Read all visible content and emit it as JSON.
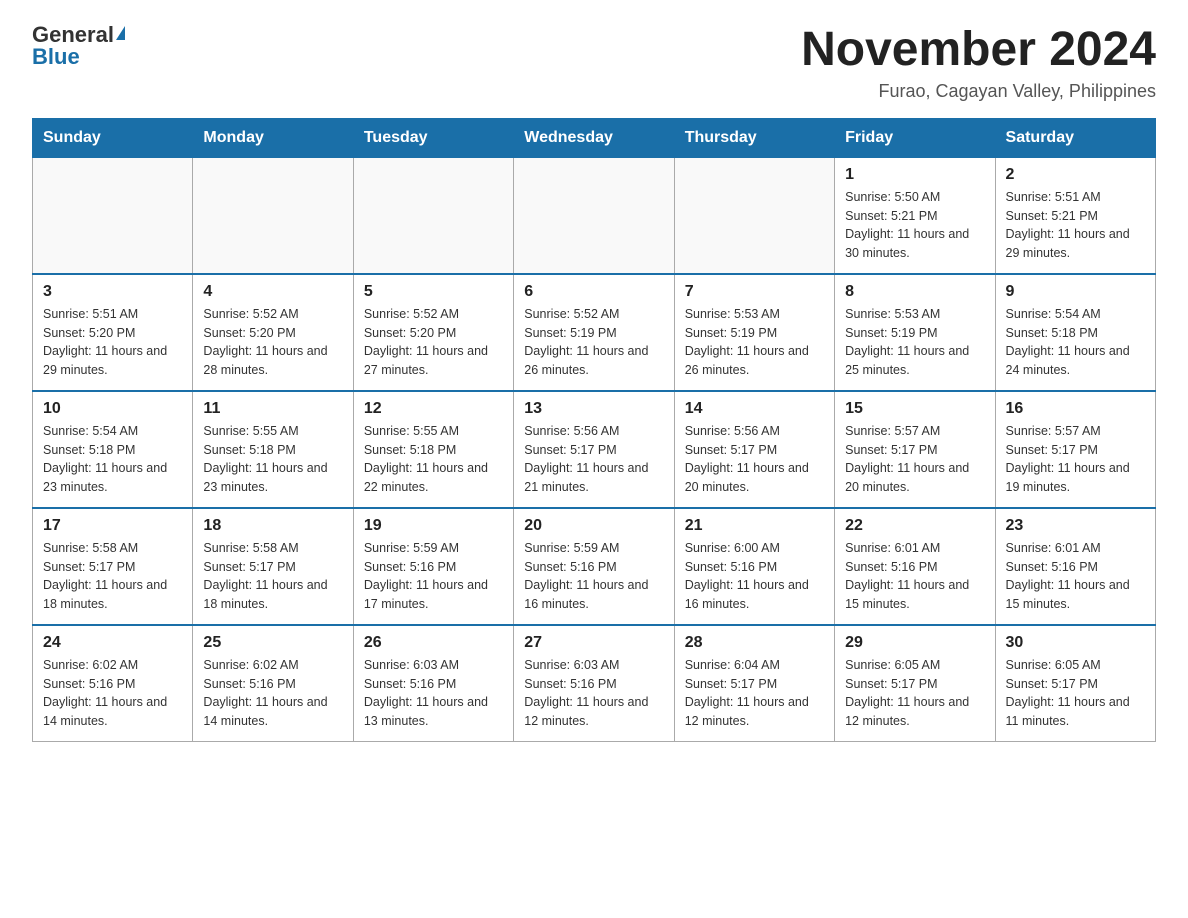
{
  "logo": {
    "general": "General",
    "blue": "Blue"
  },
  "title": "November 2024",
  "subtitle": "Furao, Cagayan Valley, Philippines",
  "weekdays": [
    "Sunday",
    "Monday",
    "Tuesday",
    "Wednesday",
    "Thursday",
    "Friday",
    "Saturday"
  ],
  "weeks": [
    [
      {
        "day": "",
        "info": ""
      },
      {
        "day": "",
        "info": ""
      },
      {
        "day": "",
        "info": ""
      },
      {
        "day": "",
        "info": ""
      },
      {
        "day": "",
        "info": ""
      },
      {
        "day": "1",
        "info": "Sunrise: 5:50 AM\nSunset: 5:21 PM\nDaylight: 11 hours and 30 minutes."
      },
      {
        "day": "2",
        "info": "Sunrise: 5:51 AM\nSunset: 5:21 PM\nDaylight: 11 hours and 29 minutes."
      }
    ],
    [
      {
        "day": "3",
        "info": "Sunrise: 5:51 AM\nSunset: 5:20 PM\nDaylight: 11 hours and 29 minutes."
      },
      {
        "day": "4",
        "info": "Sunrise: 5:52 AM\nSunset: 5:20 PM\nDaylight: 11 hours and 28 minutes."
      },
      {
        "day": "5",
        "info": "Sunrise: 5:52 AM\nSunset: 5:20 PM\nDaylight: 11 hours and 27 minutes."
      },
      {
        "day": "6",
        "info": "Sunrise: 5:52 AM\nSunset: 5:19 PM\nDaylight: 11 hours and 26 minutes."
      },
      {
        "day": "7",
        "info": "Sunrise: 5:53 AM\nSunset: 5:19 PM\nDaylight: 11 hours and 26 minutes."
      },
      {
        "day": "8",
        "info": "Sunrise: 5:53 AM\nSunset: 5:19 PM\nDaylight: 11 hours and 25 minutes."
      },
      {
        "day": "9",
        "info": "Sunrise: 5:54 AM\nSunset: 5:18 PM\nDaylight: 11 hours and 24 minutes."
      }
    ],
    [
      {
        "day": "10",
        "info": "Sunrise: 5:54 AM\nSunset: 5:18 PM\nDaylight: 11 hours and 23 minutes."
      },
      {
        "day": "11",
        "info": "Sunrise: 5:55 AM\nSunset: 5:18 PM\nDaylight: 11 hours and 23 minutes."
      },
      {
        "day": "12",
        "info": "Sunrise: 5:55 AM\nSunset: 5:18 PM\nDaylight: 11 hours and 22 minutes."
      },
      {
        "day": "13",
        "info": "Sunrise: 5:56 AM\nSunset: 5:17 PM\nDaylight: 11 hours and 21 minutes."
      },
      {
        "day": "14",
        "info": "Sunrise: 5:56 AM\nSunset: 5:17 PM\nDaylight: 11 hours and 20 minutes."
      },
      {
        "day": "15",
        "info": "Sunrise: 5:57 AM\nSunset: 5:17 PM\nDaylight: 11 hours and 20 minutes."
      },
      {
        "day": "16",
        "info": "Sunrise: 5:57 AM\nSunset: 5:17 PM\nDaylight: 11 hours and 19 minutes."
      }
    ],
    [
      {
        "day": "17",
        "info": "Sunrise: 5:58 AM\nSunset: 5:17 PM\nDaylight: 11 hours and 18 minutes."
      },
      {
        "day": "18",
        "info": "Sunrise: 5:58 AM\nSunset: 5:17 PM\nDaylight: 11 hours and 18 minutes."
      },
      {
        "day": "19",
        "info": "Sunrise: 5:59 AM\nSunset: 5:16 PM\nDaylight: 11 hours and 17 minutes."
      },
      {
        "day": "20",
        "info": "Sunrise: 5:59 AM\nSunset: 5:16 PM\nDaylight: 11 hours and 16 minutes."
      },
      {
        "day": "21",
        "info": "Sunrise: 6:00 AM\nSunset: 5:16 PM\nDaylight: 11 hours and 16 minutes."
      },
      {
        "day": "22",
        "info": "Sunrise: 6:01 AM\nSunset: 5:16 PM\nDaylight: 11 hours and 15 minutes."
      },
      {
        "day": "23",
        "info": "Sunrise: 6:01 AM\nSunset: 5:16 PM\nDaylight: 11 hours and 15 minutes."
      }
    ],
    [
      {
        "day": "24",
        "info": "Sunrise: 6:02 AM\nSunset: 5:16 PM\nDaylight: 11 hours and 14 minutes."
      },
      {
        "day": "25",
        "info": "Sunrise: 6:02 AM\nSunset: 5:16 PM\nDaylight: 11 hours and 14 minutes."
      },
      {
        "day": "26",
        "info": "Sunrise: 6:03 AM\nSunset: 5:16 PM\nDaylight: 11 hours and 13 minutes."
      },
      {
        "day": "27",
        "info": "Sunrise: 6:03 AM\nSunset: 5:16 PM\nDaylight: 11 hours and 12 minutes."
      },
      {
        "day": "28",
        "info": "Sunrise: 6:04 AM\nSunset: 5:17 PM\nDaylight: 11 hours and 12 minutes."
      },
      {
        "day": "29",
        "info": "Sunrise: 6:05 AM\nSunset: 5:17 PM\nDaylight: 11 hours and 12 minutes."
      },
      {
        "day": "30",
        "info": "Sunrise: 6:05 AM\nSunset: 5:17 PM\nDaylight: 11 hours and 11 minutes."
      }
    ]
  ]
}
